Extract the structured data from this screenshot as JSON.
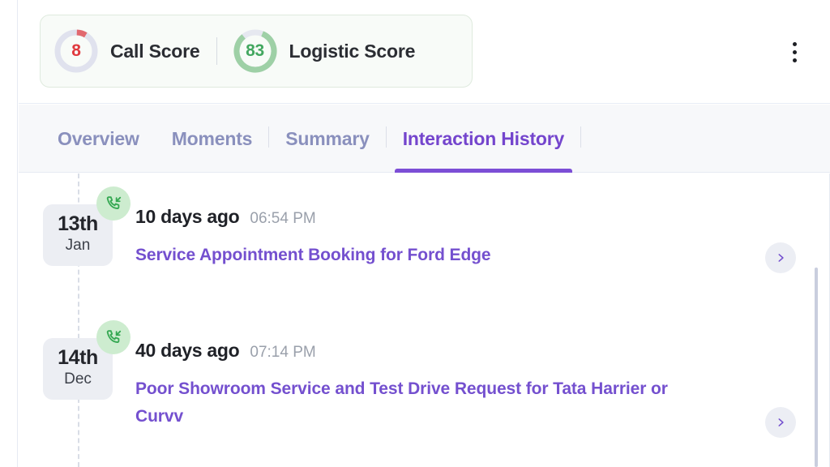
{
  "scorecard": {
    "call_score": {
      "value": "8",
      "label": "Call Score",
      "percent": 8,
      "color": "#e0393e",
      "track_color": "#e0e2ee"
    },
    "logistic_score": {
      "value": "83",
      "label": "Logistic Score",
      "percent": 83,
      "color": "#9ed0a6",
      "track_color": "#e6e8f0"
    },
    "card_bg": "#f8fbf8",
    "card_border": "#dfeade"
  },
  "header": {
    "menu_icon": "kebab-menu-icon"
  },
  "tabs": {
    "accent": "#7c4ed6",
    "inactive_color": "#8a90bd",
    "items": [
      {
        "label": "Overview",
        "active": false
      },
      {
        "label": "Moments",
        "active": false
      },
      {
        "label": "Summary",
        "active": false
      },
      {
        "label": "Interaction History",
        "active": true
      }
    ]
  },
  "timeline": {
    "entries": [
      {
        "day": "13th",
        "month": "Jan",
        "icon": "incoming-call-icon",
        "ago": "10 days ago",
        "time": "06:54 PM",
        "title": "Service Appointment Booking for Ford Edge",
        "chevron": "chevron-right-icon"
      },
      {
        "day": "14th",
        "month": "Dec",
        "icon": "incoming-call-icon",
        "ago": "40 days ago",
        "time": "07:14 PM",
        "title": "Poor Showroom Service and Test Drive Request for Tata Harrier or Curvv",
        "chevron": "chevron-right-icon"
      }
    ]
  }
}
